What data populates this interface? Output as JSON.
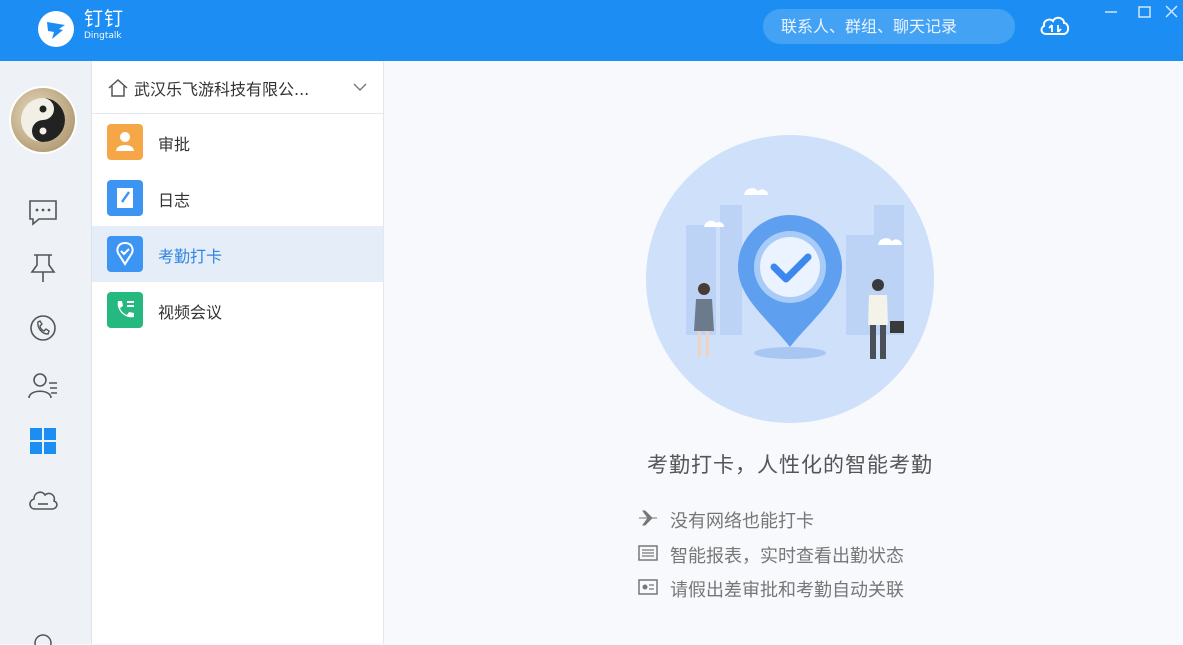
{
  "app": {
    "name_cn": "钉钉",
    "name_en": "Dingtalk",
    "brand_color": "#1c8ef3"
  },
  "search": {
    "placeholder": "联系人、群组、聊天记录",
    "value": ""
  },
  "window_controls": [
    "minimize-icon",
    "maximize-icon",
    "close-icon"
  ],
  "left_nav": [
    {
      "icon": "chat-icon"
    },
    {
      "icon": "pin-icon"
    },
    {
      "icon": "phone-icon"
    },
    {
      "icon": "contacts-icon"
    },
    {
      "icon": "workbench-grid-icon",
      "active": true
    },
    {
      "icon": "cloud-drive-icon"
    }
  ],
  "org": {
    "name": "武汉乐飞游科技有限公...",
    "icon": "home-icon"
  },
  "apps": [
    {
      "label": "审批",
      "icon": "approval-icon",
      "color": "#f5a646"
    },
    {
      "label": "日志",
      "icon": "log-icon",
      "color": "#3d95f3"
    },
    {
      "label": "考勤打卡",
      "icon": "attendance-icon",
      "color": "#3d95f3",
      "active": true
    },
    {
      "label": "视频会议",
      "icon": "video-meeting-icon",
      "color": "#25b97f"
    }
  ],
  "main": {
    "headline": "考勤打卡，人性化的智能考勤",
    "features": [
      {
        "icon": "airplane-icon",
        "text": "没有网络也能打卡"
      },
      {
        "icon": "report-icon",
        "text": "智能报表，实时查看出勤状态"
      },
      {
        "icon": "id-card-icon",
        "text": "请假出差审批和考勤自动关联"
      }
    ]
  }
}
